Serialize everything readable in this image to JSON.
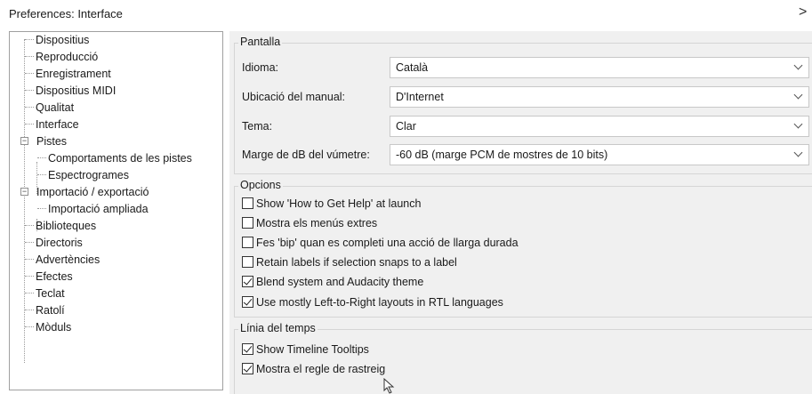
{
  "window": {
    "title": "Preferences: Interface",
    "close_glyph": ">"
  },
  "tree": {
    "items": [
      {
        "label": "Dispositius",
        "level": 1
      },
      {
        "label": "Reproducció",
        "level": 1
      },
      {
        "label": "Enregistrament",
        "level": 1
      },
      {
        "label": "Dispositius MIDI",
        "level": 1
      },
      {
        "label": "Qualitat",
        "level": 1
      },
      {
        "label": "Interface",
        "level": 1,
        "selected": true
      },
      {
        "label": "Pistes",
        "level": 1,
        "expanded": true
      },
      {
        "label": "Comportaments de les pistes",
        "level": 2
      },
      {
        "label": "Espectrogrames",
        "level": 2
      },
      {
        "label": "Importació / exportació",
        "level": 1,
        "expanded": true
      },
      {
        "label": "Importació ampliada",
        "level": 2
      },
      {
        "label": "Biblioteques",
        "level": 1
      },
      {
        "label": "Directoris",
        "level": 1
      },
      {
        "label": "Advertències",
        "level": 1
      },
      {
        "label": "Efectes",
        "level": 1
      },
      {
        "label": "Teclat",
        "level": 1
      },
      {
        "label": "Ratolí",
        "level": 1
      },
      {
        "label": "Mòduls",
        "level": 1
      }
    ]
  },
  "pantalla": {
    "title": "Pantalla",
    "fields": [
      {
        "label": "Idioma:",
        "value": "Català"
      },
      {
        "label": "Ubicació del manual:",
        "value": "D'Internet"
      },
      {
        "label": "Tema:",
        "value": "Clar"
      },
      {
        "label": "Marge de dB del vúmetre:",
        "value": "-60 dB (marge PCM de mostres de 10 bits)"
      }
    ]
  },
  "opcions": {
    "title": "Opcions",
    "checks": [
      {
        "label": "Show 'How to Get Help' at launch",
        "checked": false
      },
      {
        "label": "Mostra els menús extres",
        "checked": false
      },
      {
        "label": "Fes 'bip' quan es completi una acció de llarga durada",
        "checked": false
      },
      {
        "label": "Retain labels if selection snaps to a label",
        "checked": false
      },
      {
        "label": "Blend system and Audacity theme",
        "checked": true
      },
      {
        "label": "Use mostly Left-to-Right layouts in RTL languages",
        "checked": true
      }
    ]
  },
  "timeline": {
    "title": "Línia del temps",
    "checks": [
      {
        "label": "Show Timeline Tooltips",
        "checked": true
      },
      {
        "label": "Mostra el regle de rastreig",
        "checked": true
      }
    ]
  }
}
